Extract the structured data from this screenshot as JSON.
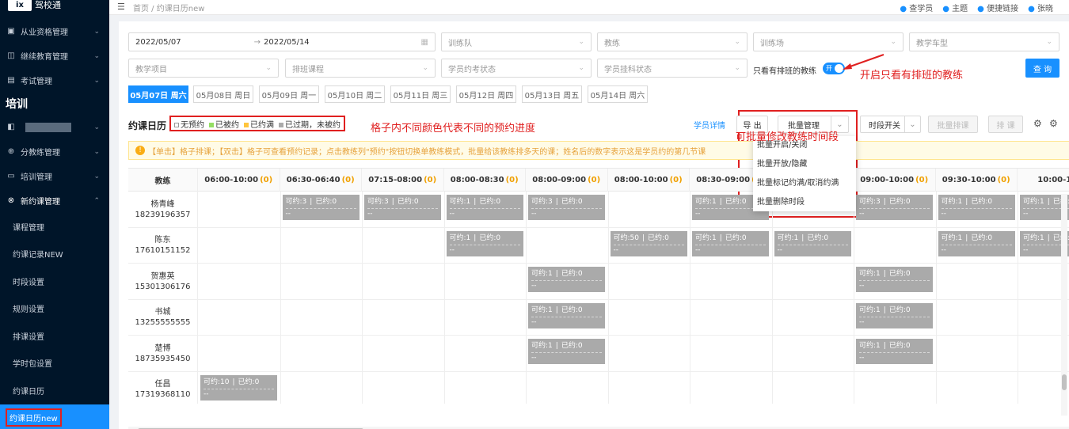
{
  "sidebar": {
    "logo": "ix",
    "logo_text": "驾校通",
    "items": [
      {
        "label": "从业资格管理",
        "icon": "▣"
      },
      {
        "label": "继续教育管理",
        "icon": "◫"
      },
      {
        "label": "考试管理",
        "icon": "▤"
      }
    ],
    "section": "培训",
    "items2": [
      {
        "label": "分教练管理",
        "icon": "⊕"
      },
      {
        "label": "培训管理",
        "icon": "▭"
      },
      {
        "label": "新约课管理",
        "icon": "⊗"
      }
    ],
    "subitems": [
      "课程管理",
      "约课记录NEW",
      "时段设置",
      "规则设置",
      "排课设置",
      "学时包设置",
      "约课日历",
      "约课日历new"
    ]
  },
  "header": {
    "breadcrumb": "首页 / 约课日历new",
    "right_items": [
      "查学员",
      "主题",
      "便捷链接",
      "张晓"
    ]
  },
  "filters": {
    "date_start": "2022/05/07",
    "date_sep": "→",
    "date_end": "2022/05/14",
    "team_placeholder": "训练队",
    "coach_placeholder": "教练",
    "field_placeholder": "训练场",
    "car_type_placeholder": "教学车型",
    "project_placeholder": "教学项目",
    "schedule_placeholder": "排班课程",
    "student_exam_placeholder": "学员约考状态",
    "student_status_placeholder": "学员挂科状态",
    "only_scheduled_label": "只看有排班的教练",
    "toggle_label": "开",
    "query_label": "查 询",
    "annotation_toggle": "开启只看有排班的教练"
  },
  "date_tabs": [
    "05月07日 周六",
    "05月08日 周日",
    "05月09日 周一",
    "05月10日 周二",
    "05月11日 周三",
    "05月12日 周四",
    "05月13日 周五",
    "05月14日 周六"
  ],
  "toolbar": {
    "title": "约课日历",
    "legend": [
      {
        "label": "无预约",
        "color": "#ffffff"
      },
      {
        "label": "已被约",
        "color": "#95de64"
      },
      {
        "label": "已约满",
        "color": "#ffc53d"
      },
      {
        "label": "已过期，未被约",
        "color": "#aaaaaa"
      }
    ],
    "annotation_legend": "格子内不同颜色代表不同的预约进度",
    "student_detail": "学员详情",
    "export": "导 出",
    "batch_manage": "批量管理",
    "slot_switch": "时段开关",
    "batch_schedule": "批量排课",
    "schedule": "排 课",
    "annotation_batch": "可批量修改教练时间段"
  },
  "dropdown": [
    "批量开启/关闭",
    "批量开放/隐藏",
    "批量标记约满/取消约满",
    "批量删除时段"
  ],
  "notice": "【单击】格子排课；【双击】格子可查看预约记录；点击教练列\"预约\"按钮切换单教练模式，批量给该教练排多天的课；姓名后的数字表示这是学员约的第几节课",
  "grid": {
    "coach_header": "教练",
    "columns": [
      {
        "time": "06:00-10:00",
        "count": "(0)"
      },
      {
        "time": "06:30-06:40",
        "count": "(0)"
      },
      {
        "time": "07:15-08:00",
        "count": "(0)"
      },
      {
        "time": "08:00-08:30",
        "count": "(0)"
      },
      {
        "time": "08:00-09:00",
        "count": "(0)"
      },
      {
        "time": "08:00-10:00",
        "count": "(0)"
      },
      {
        "time": "08:30-09:00",
        "count": "(0)"
      },
      {
        "time": "09:00-09:30",
        "count": "(0)"
      },
      {
        "time": "09:00-10:00",
        "count": "(0)"
      },
      {
        "time": "09:30-10:00",
        "count": "(0)"
      },
      {
        "time": "10:00-10",
        "count": ""
      }
    ],
    "rows": [
      {
        "name": "杨青峰",
        "phone": "18239196357",
        "slots": [
          {
            "col": 1,
            "avail": "可约:3",
            "booked": "已约:0"
          },
          {
            "col": 2,
            "avail": "可约:3",
            "booked": "已约:0"
          },
          {
            "col": 3,
            "avail": "可约:1",
            "booked": "已约:0"
          },
          {
            "col": 4,
            "avail": "可约:3",
            "booked": "已约:0"
          },
          {
            "col": 6,
            "avail": "可约:1",
            "booked": "已约:0"
          },
          {
            "col": 8,
            "avail": "可约:3",
            "booked": "已约:0"
          },
          {
            "col": 9,
            "avail": "可约:1",
            "booked": "已约:0"
          },
          {
            "col": 10,
            "avail": "可约:1",
            "booked": "已约:0"
          }
        ]
      },
      {
        "name": "陈东",
        "phone": "17610151152",
        "slots": [
          {
            "col": 3,
            "avail": "可约:1",
            "booked": "已约:0"
          },
          {
            "col": 5,
            "avail": "可约:50",
            "booked": "已约:0"
          },
          {
            "col": 6,
            "avail": "可约:1",
            "booked": "已约:0"
          },
          {
            "col": 7,
            "avail": "可约:1",
            "booked": "已约:0"
          },
          {
            "col": 9,
            "avail": "可约:1",
            "booked": "已约:0"
          },
          {
            "col": 10,
            "avail": "可约:1",
            "booked": "已约:0"
          }
        ]
      },
      {
        "name": "贺惠英",
        "phone": "15301306176",
        "slots": [
          {
            "col": 4,
            "avail": "可约:1",
            "booked": "已约:0"
          },
          {
            "col": 8,
            "avail": "可约:1",
            "booked": "已约:0"
          }
        ]
      },
      {
        "name": "书城",
        "phone": "13255555555",
        "slots": [
          {
            "col": 4,
            "avail": "可约:1",
            "booked": "已约:0"
          },
          {
            "col": 8,
            "avail": "可约:1",
            "booked": "已约:0"
          }
        ]
      },
      {
        "name": "楚博",
        "phone": "18735935450",
        "slots": [
          {
            "col": 4,
            "avail": "可约:1",
            "booked": "已约:0"
          },
          {
            "col": 8,
            "avail": "可约:1",
            "booked": "已约:0"
          }
        ]
      },
      {
        "name": "任昌",
        "phone": "17319368110",
        "slots": [
          {
            "col": 0,
            "avail": "可约:10",
            "booked": "已约:0"
          }
        ]
      }
    ],
    "slot_dash": "--"
  },
  "colors": {
    "accent": "#1890ff",
    "annotation": "#e02020",
    "sidebar": "#001529",
    "slot": "#aaaaaa"
  }
}
